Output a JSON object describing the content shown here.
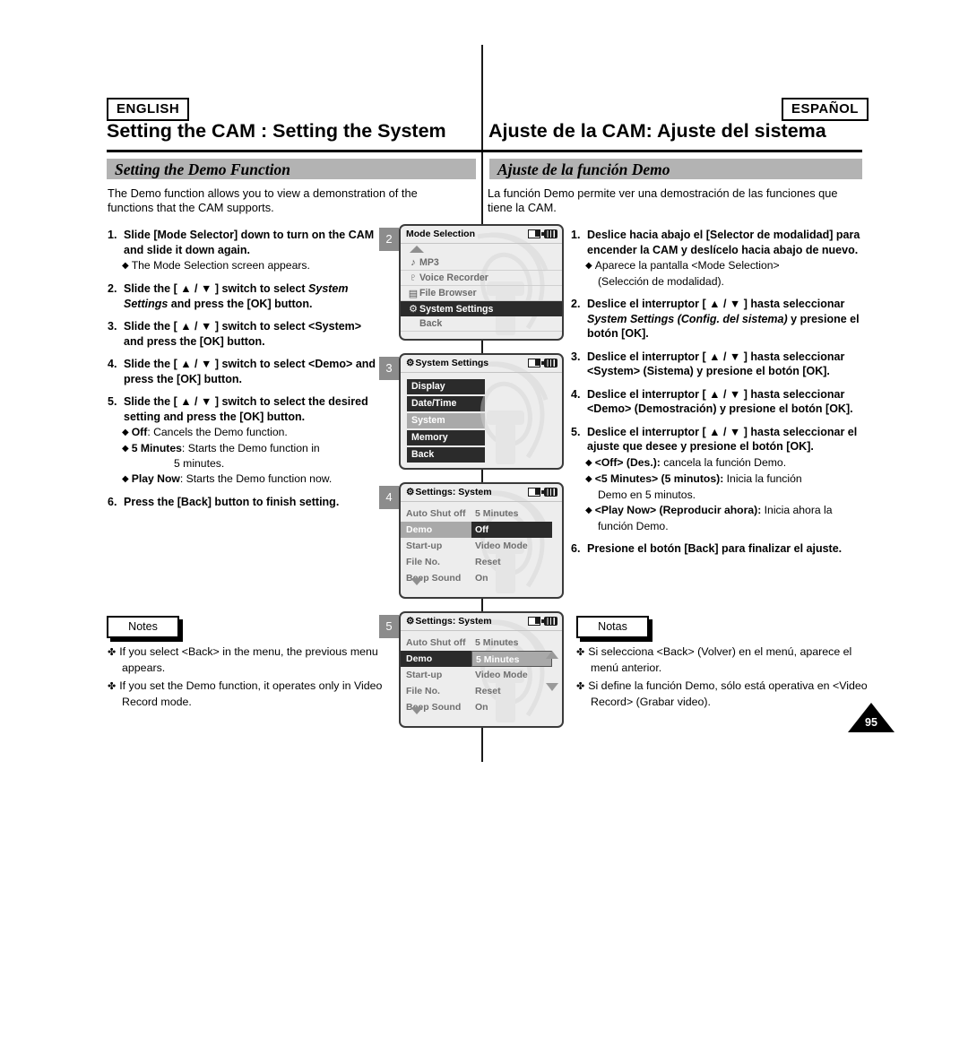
{
  "language_tags": {
    "english": "ENGLISH",
    "espanol": "ESPAÑOL"
  },
  "header": {
    "title_en": "Setting the CAM : Setting the System",
    "title_es": "Ajuste de la CAM: Ajuste del sistema"
  },
  "banner": {
    "en": "Setting the Demo Function",
    "es": "Ajuste de la función Demo"
  },
  "intro": {
    "en": "The Demo function allows you to view a demonstration of the functions that the CAM supports.",
    "es": "La función Demo permite ver una demostración de las funciones que tiene la CAM."
  },
  "steps_en": [
    {
      "num": "1.",
      "head_a": "Slide [Mode Selector] down to turn on the CAM and slide it down again.",
      "subs": [
        {
          "bullet": "◆",
          "bold": "",
          "text": "The Mode Selection screen appears."
        }
      ]
    },
    {
      "num": "2.",
      "head_a": "Slide the [ ▲ / ▼ ] switch to select ",
      "head_ital": "System Settings",
      "head_b": " and press the [OK] button.",
      "subs": []
    },
    {
      "num": "3.",
      "head_a": "Slide the [ ▲ / ▼ ] switch to select <System> and press the [OK] button.",
      "subs": []
    },
    {
      "num": "4.",
      "head_a": "Slide the [ ▲ / ▼ ] switch to select <Demo> and press the [OK] button.",
      "subs": []
    },
    {
      "num": "5.",
      "head_a": "Slide the [ ▲ / ▼ ] switch to select the desired setting and press the [OK] button.",
      "subs": [
        {
          "bullet": "◆",
          "bold": "Off",
          "text": ": Cancels the Demo function."
        },
        {
          "bullet": "◆",
          "bold": "5 Minutes",
          "text": ": Starts the Demo function in"
        },
        {
          "bullet": "",
          "bold": "",
          "text": "5 minutes.",
          "indent": true
        },
        {
          "bullet": "◆",
          "bold": "Play Now",
          "text": ": Starts the Demo function now."
        }
      ]
    },
    {
      "num": "6.",
      "head_a": "Press the [Back] button to finish setting.",
      "subs": []
    }
  ],
  "steps_es": [
    {
      "num": "1.",
      "head_a": "Deslice hacia abajo el [Selector de modalidad] para encender la CAM y deslícelo hacia abajo de nuevo.",
      "subs": [
        {
          "bullet": "◆",
          "bold": "",
          "text": "Aparece la pantalla <Mode Selection>"
        },
        {
          "bullet": "",
          "bold": "",
          "text": "(Selección de modalidad).",
          "pad": true
        }
      ]
    },
    {
      "num": "2.",
      "head_a": "Deslice el interruptor [ ▲ / ▼ ] hasta seleccionar ",
      "head_ital": "System Settings (Config. del sistema)",
      "head_b": " y presione el botón [OK].",
      "subs": []
    },
    {
      "num": "3.",
      "head_a": "Deslice el interruptor [ ▲ / ▼ ] hasta seleccionar <System>  (Sistema) y presione el botón [OK].",
      "subs": []
    },
    {
      "num": "4.",
      "head_a": "Deslice el interruptor [ ▲ / ▼ ] hasta seleccionar <Demo>  (Demostración) y presione el botón [OK].",
      "subs": []
    },
    {
      "num": "5.",
      "head_a": "Deslice el interruptor [ ▲ / ▼ ] hasta seleccionar el ajuste que desee y presione el botón [OK].",
      "subs": [
        {
          "bullet": "◆",
          "bold": "<Off> (Des.):",
          "text": " cancela la función Demo."
        },
        {
          "bullet": "◆",
          "bold": "<5 Minutes> (5 minutos):",
          "text": " Inicia la función"
        },
        {
          "bullet": "",
          "bold": "",
          "text": "Demo en 5 minutos.",
          "pad": true
        },
        {
          "bullet": "◆",
          "bold": "<Play Now> (Reproducir ahora):",
          "text": " Inicia ahora la"
        },
        {
          "bullet": "",
          "bold": "",
          "text": "función Demo.",
          "pad": true
        }
      ]
    },
    {
      "num": "6.",
      "head_a": "Presione el botón [Back] para finalizar el ajuste.",
      "subs": []
    }
  ],
  "notes": {
    "label_en": "Notes",
    "label_es": "Notas",
    "items_en": [
      "If you select <Back> in the menu, the previous menu appears.",
      "If you set the Demo function, it operates only in Video Record mode."
    ],
    "items_es": [
      "Si selecciona <Back> (Volver) en el menú, aparece el menú anterior.",
      "Si define la función Demo, sólo está operativa en <Video Record> (Grabar video)."
    ],
    "bullet": "✤"
  },
  "page_number": "95",
  "lcd_screens": [
    {
      "badge": "2",
      "title": "Mode Selection",
      "has_gear_icon": false,
      "type": "list",
      "top_arrow": true,
      "rows": [
        {
          "icon": "♪",
          "icon_name": "music-note-icon",
          "label": "MP3",
          "selected": false
        },
        {
          "icon": "♇",
          "icon_name": "microphone-icon",
          "label": "Voice Recorder",
          "selected": false
        },
        {
          "icon": "▤",
          "icon_name": "file-browser-icon",
          "label": "File Browser",
          "selected": false
        },
        {
          "icon": "⚙",
          "icon_name": "system-settings-icon",
          "label": "System Settings",
          "selected": true
        },
        {
          "icon": "",
          "icon_name": "none",
          "label": "Back",
          "selected": false
        }
      ]
    },
    {
      "badge": "3",
      "title": "System Settings",
      "has_gear_icon": true,
      "type": "buttons",
      "rows": [
        {
          "label": "Display",
          "state": "normal"
        },
        {
          "label": "Date/Time",
          "state": "normal"
        },
        {
          "label": "System",
          "state": "highlight"
        },
        {
          "label": "Memory",
          "state": "normal"
        },
        {
          "label": "Back",
          "state": "normal"
        }
      ]
    },
    {
      "badge": "4",
      "title": "Settings: System",
      "has_gear_icon": true,
      "type": "keyvalue",
      "bottom_arrow": true,
      "scroll_arrows": false,
      "rows": [
        {
          "key": "Auto Shut off",
          "value": "5 Minutes",
          "key_state": "none",
          "val_state": "none"
        },
        {
          "key": "Demo",
          "value": "Off",
          "key_state": "gray",
          "val_state": "dark"
        },
        {
          "key": "Start-up",
          "value": "Video Mode",
          "key_state": "none",
          "val_state": "none"
        },
        {
          "key": "File No.",
          "value": "Reset",
          "key_state": "none",
          "val_state": "none"
        },
        {
          "key": "Beep Sound",
          "value": "On",
          "key_state": "none",
          "val_state": "none"
        }
      ]
    },
    {
      "badge": "5",
      "title": "Settings: System",
      "has_gear_icon": true,
      "type": "keyvalue",
      "bottom_arrow": true,
      "scroll_arrows": true,
      "rows": [
        {
          "key": "Auto Shut off",
          "value": "5 Minutes",
          "key_state": "none",
          "val_state": "none"
        },
        {
          "key": "Demo",
          "value": "5 Minutes",
          "key_state": "dark",
          "val_state": "gray"
        },
        {
          "key": "Start-up",
          "value": "Video Mode",
          "key_state": "none",
          "val_state": "none"
        },
        {
          "key": "File No.",
          "value": "Reset",
          "key_state": "none",
          "val_state": "none"
        },
        {
          "key": "Beep Sound",
          "value": "On",
          "key_state": "none",
          "val_state": "none"
        }
      ]
    }
  ]
}
